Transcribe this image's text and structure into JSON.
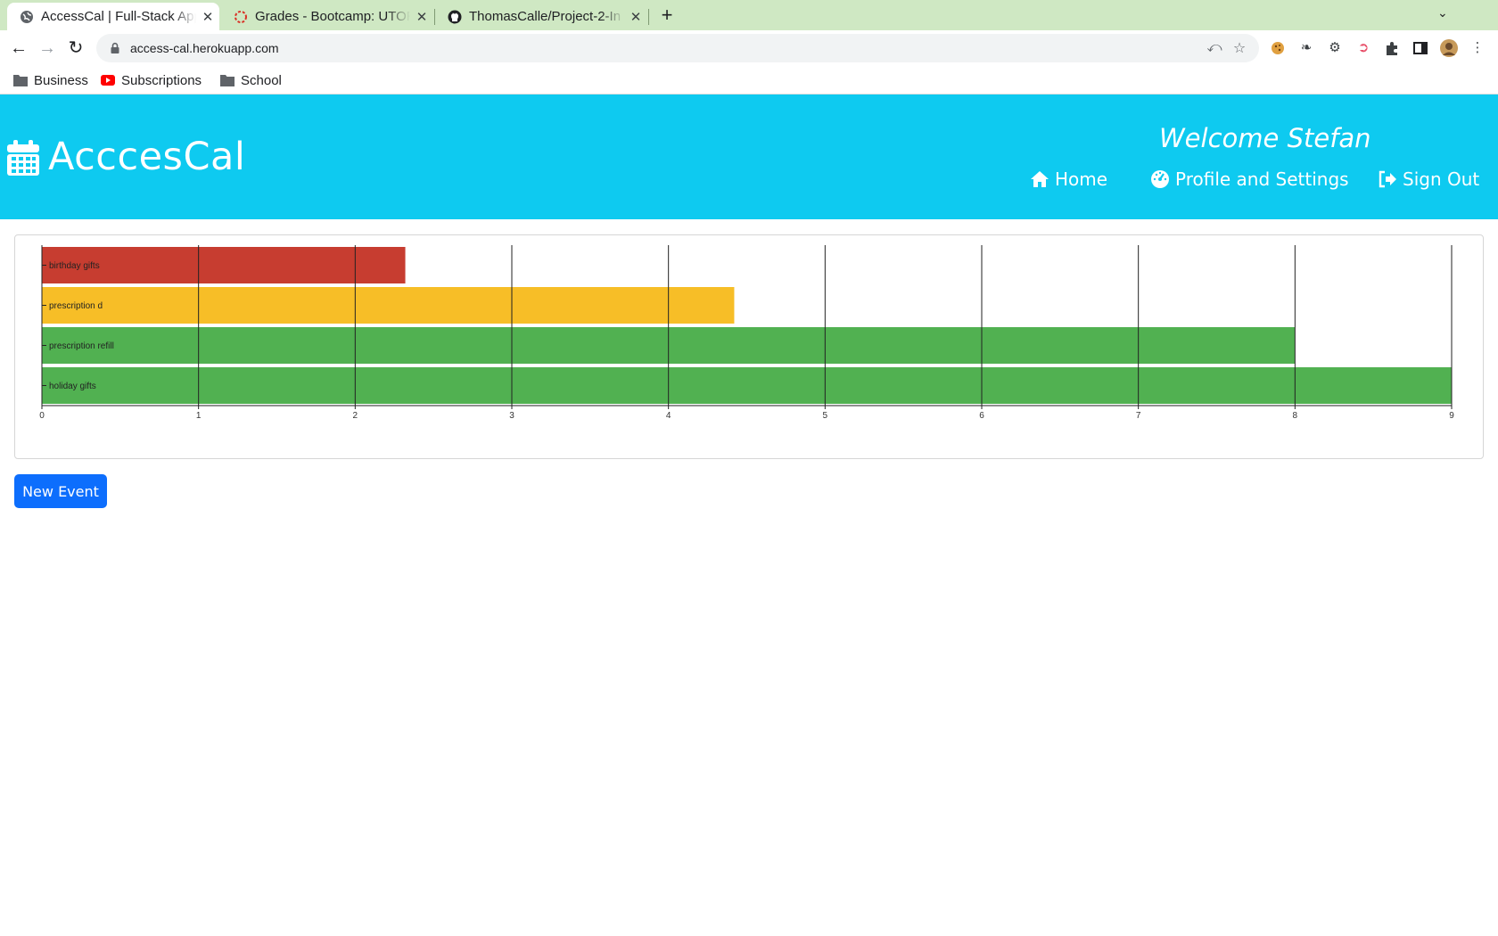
{
  "browser": {
    "tabs": [
      {
        "title": "AccessCal | Full-Stack App",
        "icon": "globe-icon",
        "active": true
      },
      {
        "title": "Grades - Bootcamp: UTOR",
        "icon": "loading-ring-icon",
        "active": false
      },
      {
        "title": "ThomasCalle/Project-2-In",
        "icon": "github-icon",
        "active": false
      }
    ],
    "url": "access-cal.herokuapp.com",
    "bookmarks": [
      {
        "label": "Business",
        "icon": "folder-icon"
      },
      {
        "label": "Subscriptions",
        "icon": "youtube-icon"
      },
      {
        "label": "School",
        "icon": "folder-icon"
      }
    ]
  },
  "app": {
    "brand": "AcccesCal",
    "welcome": "Welcome Stefan",
    "nav": {
      "home": "Home",
      "profile": "Profile and Settings",
      "signout": "Sign Out"
    },
    "new_event_label": "New Event",
    "colors": {
      "header_bg": "#0ecaf0",
      "button_bg": "#0d6efd"
    }
  },
  "chart_data": {
    "type": "bar",
    "orientation": "horizontal",
    "categories": [
      "birthday gifts",
      "prescription d",
      "prescription refill",
      "holiday gifts"
    ],
    "values": [
      2.32,
      4.42,
      8.0,
      9.0
    ],
    "colors": [
      "#c73d30",
      "#f7be27",
      "#51b151",
      "#51b151"
    ],
    "xlim": [
      0,
      9
    ],
    "xticks": [
      0,
      1,
      2,
      3,
      4,
      5,
      6,
      7,
      8,
      9
    ],
    "grid": true
  }
}
